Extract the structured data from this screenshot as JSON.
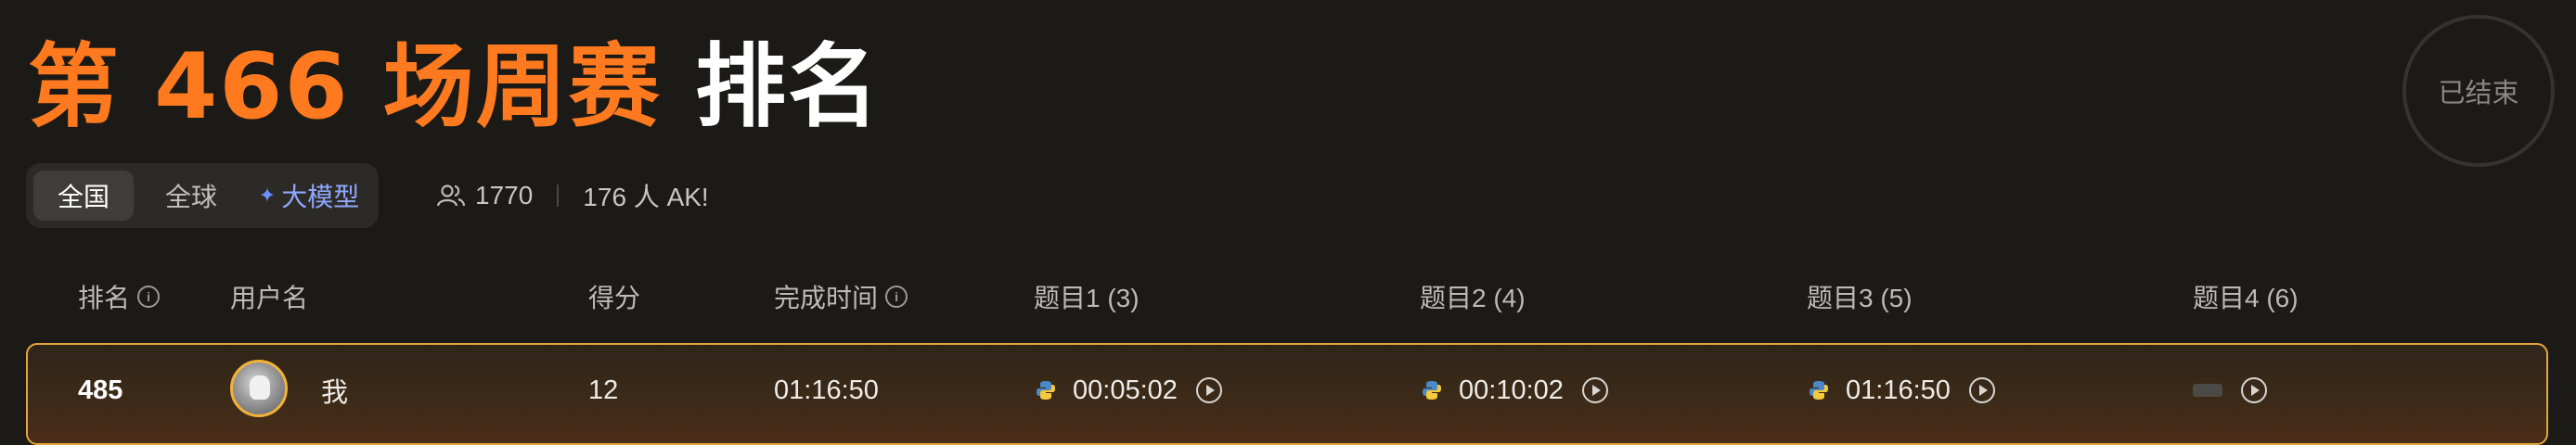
{
  "title": {
    "contest": "第 466 场周赛",
    "suffix": "排名"
  },
  "status_label": "已结束",
  "tabs": [
    {
      "label": "全国",
      "active": true
    },
    {
      "label": "全球",
      "active": false
    },
    {
      "label": "大模型",
      "active": false,
      "icon": "sparkle-icon"
    }
  ],
  "stats": {
    "participants": "1770",
    "ak_text": "176 人 AK!"
  },
  "columns": {
    "rank": "排名",
    "username": "用户名",
    "score": "得分",
    "finish_time": "完成时间",
    "q1": "题目1 (3)",
    "q2": "题目2 (4)",
    "q3": "题目3 (5)",
    "q4": "题目4 (6)"
  },
  "my_row": {
    "rank": "485",
    "username": "我",
    "score": "12",
    "finish_time": "01:16:50",
    "q1_time": "00:05:02",
    "q2_time": "00:10:02",
    "q3_time": "01:16:50",
    "language_icon": "python-icon"
  },
  "colors": {
    "accent": "#ff7a1f",
    "highlight_border": "#e2a63a",
    "background": "#1c1a17",
    "ai_tab": "#8fa7ff"
  }
}
